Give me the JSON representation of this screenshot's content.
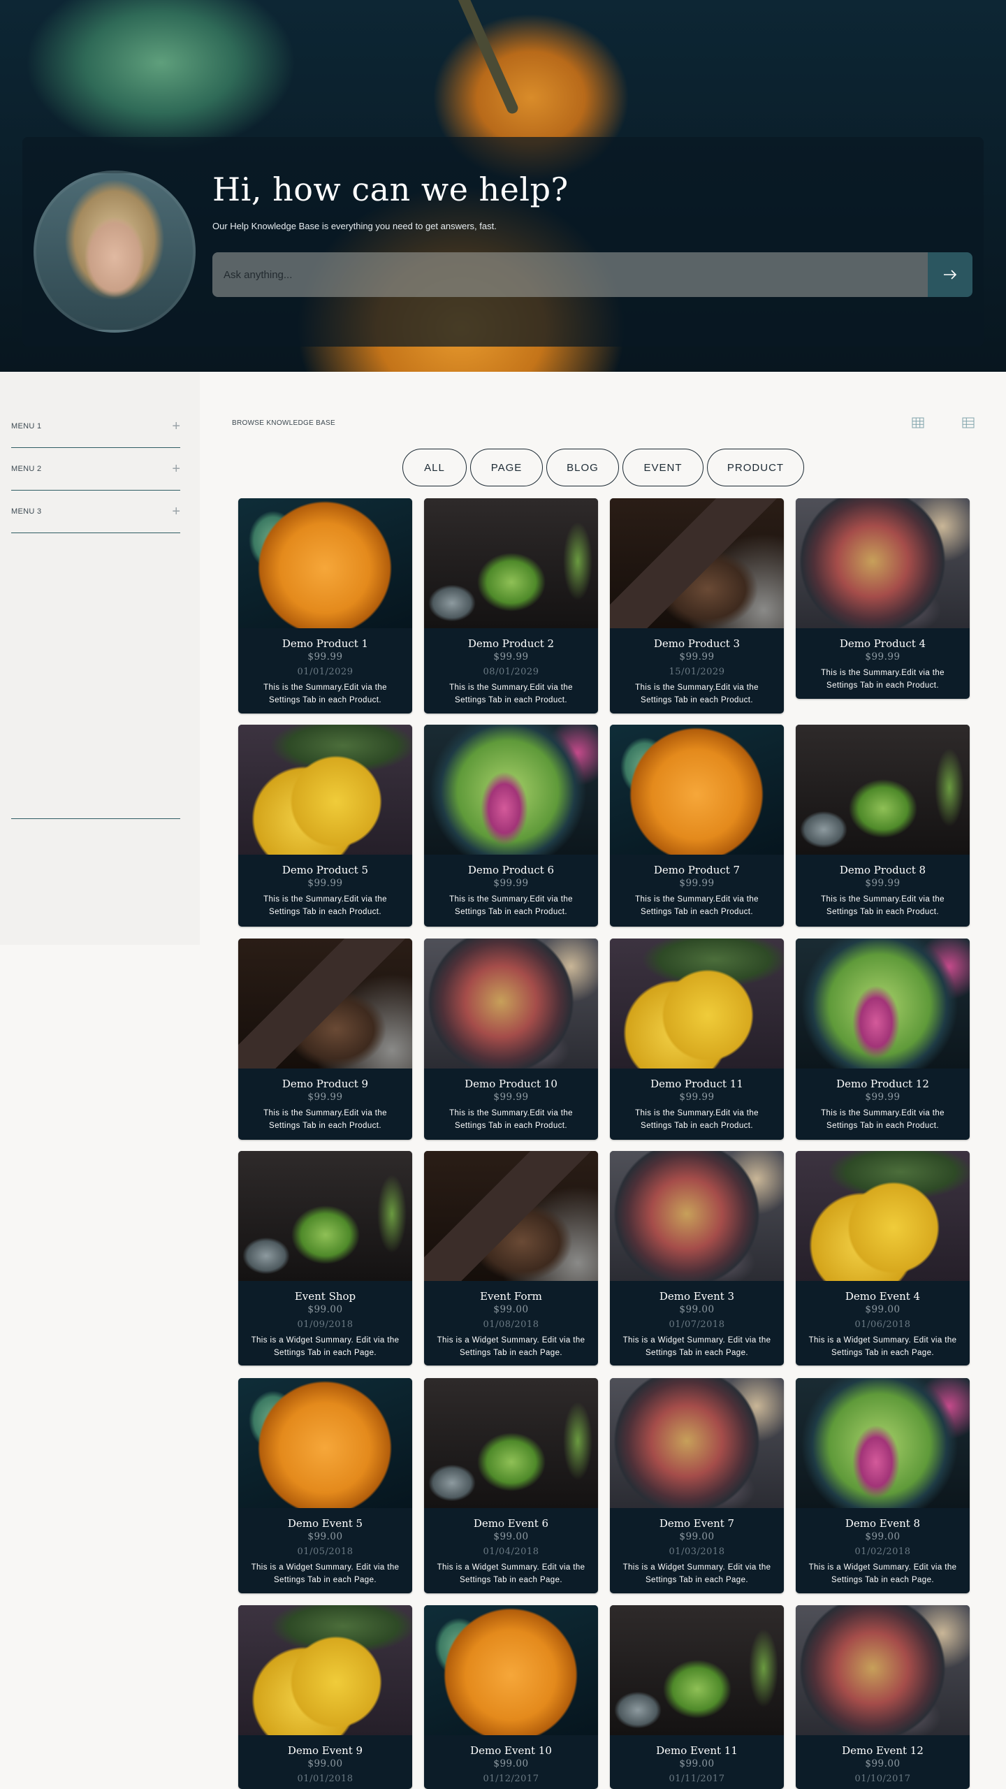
{
  "hero": {
    "title": "Hi, how can we help?",
    "subtitle": "Our Help Knowledge Base is everything you need to get answers, fast.",
    "search_placeholder": "Ask anything...",
    "search_button_icon": "arrow-right-icon"
  },
  "sidebar": {
    "items": [
      {
        "label": "MENU 1",
        "icon": "plus-icon"
      },
      {
        "label": "MENU 2",
        "icon": "plus-icon"
      },
      {
        "label": "MENU 3",
        "icon": "plus-icon"
      }
    ]
  },
  "main": {
    "browse_label": "BROWSE KNOWLEDGE BASE",
    "view_icons": [
      "grid-icon",
      "table-icon"
    ],
    "filters": [
      "ALL",
      "PAGE",
      "BLOG",
      "EVENT",
      "PRODUCT"
    ],
    "cards": [
      {
        "title": "Demo Product 1",
        "price": "$99.99",
        "date": "01/01/2029",
        "summary": "This is the Summary.Edit via the Settings Tab in each Product.",
        "image": "orange"
      },
      {
        "title": "Demo Product 2",
        "price": "$99.99",
        "date": "08/01/2029",
        "summary": "This is the Summary.Edit via the Settings Tab in each Product.",
        "image": "jar"
      },
      {
        "title": "Demo Product 3",
        "price": "$99.99",
        "date": "15/01/2029",
        "summary": "This is the Summary.Edit via the Settings Tab in each Product.",
        "image": "chocolate"
      },
      {
        "title": "Demo Product 4",
        "price": "$99.99",
        "date": "",
        "summary": "This is the Summary.Edit via the Settings Tab in each Product.",
        "image": "figs"
      },
      {
        "title": "Demo Product 5",
        "price": "$99.99",
        "date": "",
        "summary": "This is the Summary.Edit via the Settings Tab in each Product.",
        "image": "lemon"
      },
      {
        "title": "Demo Product 6",
        "price": "$99.99",
        "date": "",
        "summary": "This is the Summary.Edit via the Settings Tab in each Product.",
        "image": "salad"
      },
      {
        "title": "Demo Product 7",
        "price": "$99.99",
        "date": "",
        "summary": "This is the Summary.Edit via the Settings Tab in each Product.",
        "image": "orange"
      },
      {
        "title": "Demo Product 8",
        "price": "$99.99",
        "date": "",
        "summary": "This is the Summary.Edit via the Settings Tab in each Product.",
        "image": "jar"
      },
      {
        "title": "Demo Product 9",
        "price": "$99.99",
        "date": "",
        "summary": "This is the Summary.Edit via the Settings Tab in each Product.",
        "image": "chocolate"
      },
      {
        "title": "Demo Product 10",
        "price": "$99.99",
        "date": "",
        "summary": "This is the Summary.Edit via the Settings Tab in each Product.",
        "image": "figs"
      },
      {
        "title": "Demo Product 11",
        "price": "$99.99",
        "date": "",
        "summary": "This is the Summary.Edit via the Settings Tab in each Product.",
        "image": "lemon"
      },
      {
        "title": "Demo Product 12",
        "price": "$99.99",
        "date": "",
        "summary": "This is the Summary.Edit via the Settings Tab in each Product.",
        "image": "salad"
      },
      {
        "title": "Event Shop",
        "price": "$99.00",
        "date": "01/09/2018",
        "summary": "This is a Widget Summary. Edit via the Settings Tab in each Page.",
        "image": "jar"
      },
      {
        "title": "Event Form",
        "price": "$99.00",
        "date": "01/08/2018",
        "summary": "This is a Widget Summary. Edit via the Settings Tab in each Page.",
        "image": "chocolate"
      },
      {
        "title": "Demo Event 3",
        "price": "$99.00",
        "date": "01/07/2018",
        "summary": "This is a Widget Summary. Edit via the Settings Tab in each Page.",
        "image": "figs"
      },
      {
        "title": "Demo Event 4",
        "price": "$99.00",
        "date": "01/06/2018",
        "summary": "This is a Widget Summary. Edit via the Settings Tab in each Page.",
        "image": "lemon"
      },
      {
        "title": "Demo Event 5",
        "price": "$99.00",
        "date": "01/05/2018",
        "summary": "This is a Widget Summary. Edit via the Settings Tab in each Page.",
        "image": "orange"
      },
      {
        "title": "Demo Event 6",
        "price": "$99.00",
        "date": "01/04/2018",
        "summary": "This is a Widget Summary. Edit via the Settings Tab in each Page.",
        "image": "jar"
      },
      {
        "title": "Demo Event 7",
        "price": "$99.00",
        "date": "01/03/2018",
        "summary": "This is a Widget Summary. Edit via the Settings Tab in each Page.",
        "image": "figs"
      },
      {
        "title": "Demo Event 8",
        "price": "$99.00",
        "date": "01/02/2018",
        "summary": "This is a Widget Summary. Edit via the Settings Tab in each Page.",
        "image": "salad"
      },
      {
        "title": "Demo Event 9",
        "price": "$99.00",
        "date": "01/01/2018",
        "summary": "",
        "image": "lemon"
      },
      {
        "title": "Demo Event 10",
        "price": "$99.00",
        "date": "01/12/2017",
        "summary": "",
        "image": "orange"
      },
      {
        "title": "Demo Event 11",
        "price": "$99.00",
        "date": "01/11/2017",
        "summary": "",
        "image": "jar"
      },
      {
        "title": "Demo Event 12",
        "price": "$99.00",
        "date": "01/10/2017",
        "summary": "",
        "image": "figs"
      }
    ]
  },
  "colors": {
    "card_bg": "#0c1c28",
    "accent": "#2b5660",
    "page_bg": "#f8f7f5"
  }
}
